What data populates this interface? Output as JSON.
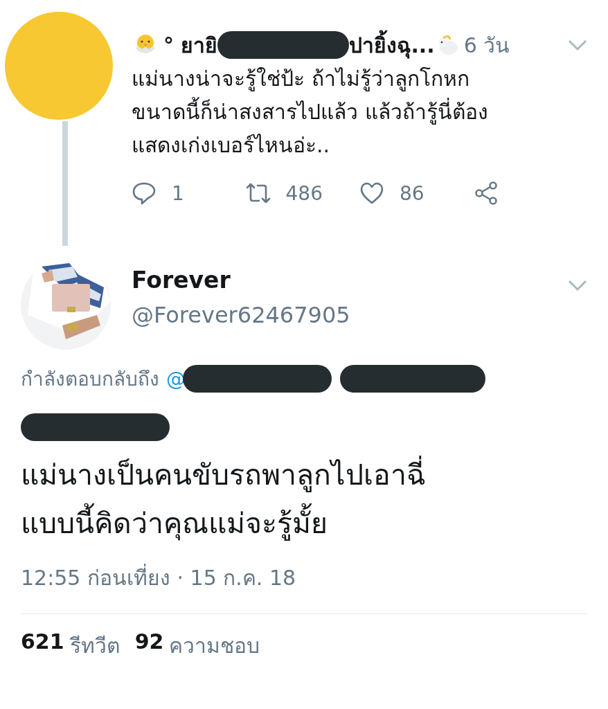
{
  "parent_tweet": {
    "name_start": "° ยายิ",
    "name_end": "ปายิ้งฉุ...",
    "time": "6 วัน",
    "text_lines": [
      "แม่นางน่าจะรู้ใช่ป้ะ ถ้าไม่รู้ว่าลูกโกหก",
      "ขนาดนี้ก็น่าสงสารไปแล้ว แล้วถ้ารู้นี่ต้อง",
      "แสดงเก่งเบอร์ไหนอ่ะ.."
    ],
    "actions": [
      {
        "kind": "reply",
        "count": "1"
      },
      {
        "kind": "retweet",
        "count": "486"
      },
      {
        "kind": "like",
        "count": "86"
      },
      {
        "kind": "share"
      }
    ]
  },
  "tweet": {
    "display_name": "Forever",
    "handle": "@Forever62467905",
    "reply_prefix": "กำลังตอบกลับถึง",
    "mention_start": "@",
    "text_lines": [
      "แม่นางเป็นคนขับรถพาลูกไปเอาฉี่",
      "แบบนี้คิดว่าคุณแม่จะรู้มั้ย"
    ],
    "timestamp": "12:55 ก่อนเที่ยง · 15 ก.ค. 18"
  },
  "stats": [
    {
      "count": "621",
      "label": "รีทวีต"
    },
    {
      "count": "92",
      "label": "ความชอบ"
    }
  ]
}
